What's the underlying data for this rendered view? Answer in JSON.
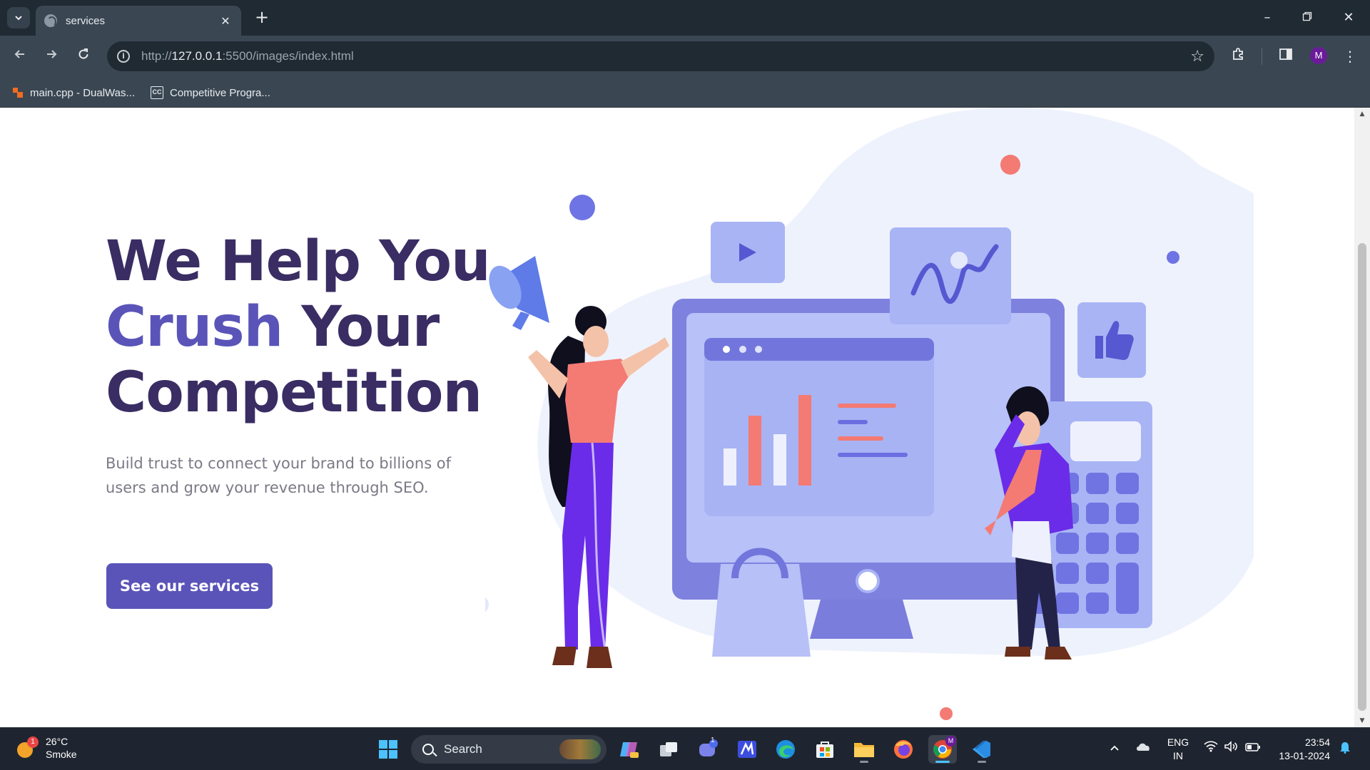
{
  "browser": {
    "tab_title": "services",
    "url_scheme": "http://",
    "url_host": "127.0.0.1",
    "url_path": ":5500/images/index.html",
    "profile_initial": "M",
    "bookmarks": [
      {
        "label": "main.cpp - DualWas..."
      },
      {
        "label": "Competitive Progra..."
      }
    ],
    "colors": {
      "frame": "#202a33",
      "toolbar": "#3a4753"
    }
  },
  "hero": {
    "title_line1": "We Help You",
    "title_accent": "Crush",
    "title_line2_rest": "Your",
    "title_line3": "Competition",
    "subtitle": "Build trust to connect your brand to billions of users and grow your revenue through SEO.",
    "cta_label": "See our services",
    "colors": {
      "heading": "#3a2d63",
      "accent": "#5a54b9",
      "body": "#7a7a86"
    }
  },
  "taskbar": {
    "weather_temp": "26°C",
    "weather_desc": "Smoke",
    "weather_badge": "1",
    "search_label": "Search",
    "teams_badge": "1",
    "lang_line1": "ENG",
    "lang_line2": "IN",
    "time": "23:54",
    "date": "13-01-2024"
  }
}
